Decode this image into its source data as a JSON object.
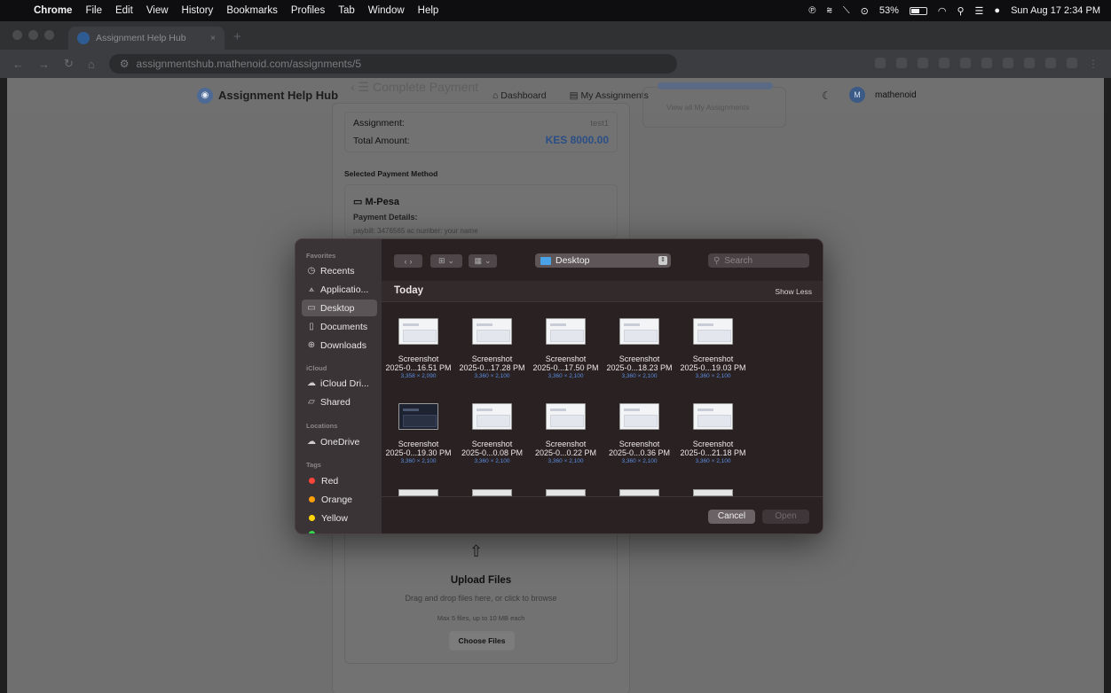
{
  "menubar": {
    "items": [
      "Chrome",
      "File",
      "Edit",
      "View",
      "History",
      "Bookmarks",
      "Profiles",
      "Tab",
      "Window",
      "Help"
    ],
    "battery": "53%",
    "datetime": "Sun Aug 17  2:34 PM"
  },
  "browser": {
    "tab_title": "Assignment Help Hub",
    "url": "assignmentshub.mathenoid.com/assignments/5"
  },
  "site": {
    "brand": "Assignment Help Hub",
    "nav_dashboard": "Dashboard",
    "nav_assignments": "My Assignments",
    "ghost_title": "Complete Payment",
    "avatar_initial": "M",
    "username": "mathenoid",
    "view_all": "View all My Assignments"
  },
  "payment": {
    "assignment_label": "Assignment:",
    "assignment_value": "test1",
    "total_label": "Total Amount:",
    "total_value": "KES 8000.00",
    "selected_method_label": "Selected Payment Method",
    "method_name": "M-Pesa",
    "details_label": "Payment Details:",
    "paybill_text": "paybill: 3476565 ac number: your name"
  },
  "upload": {
    "title": "Upload Files",
    "subtitle": "Drag and drop files here, or click to browse",
    "limits": "Max 5 files, up to 10 MB each",
    "button": "Choose Files"
  },
  "dialog": {
    "favorites_heading": "Favorites",
    "favorites": [
      "Recents",
      "Applicatio...",
      "Desktop",
      "Documents",
      "Downloads"
    ],
    "icloud_heading": "iCloud",
    "icloud": [
      "iCloud Dri...",
      "Shared"
    ],
    "locations_heading": "Locations",
    "locations": [
      "OneDrive"
    ],
    "tags_heading": "Tags",
    "tags": [
      {
        "name": "Red",
        "color": "#ff453a"
      },
      {
        "name": "Orange",
        "color": "#ff9f0a"
      },
      {
        "name": "Yellow",
        "color": "#ffd60a"
      }
    ],
    "location": "Desktop",
    "search_placeholder": "Search",
    "section": "Today",
    "show_less": "Show Less",
    "files": [
      {
        "line1": "Screenshot",
        "line2": "2025-0...16.51 PM",
        "dims": "3,358 × 2,090"
      },
      {
        "line1": "Screenshot",
        "line2": "2025-0...17.28 PM",
        "dims": "3,360 × 2,100"
      },
      {
        "line1": "Screenshot",
        "line2": "2025-0...17.50 PM",
        "dims": "3,360 × 2,100"
      },
      {
        "line1": "Screenshot",
        "line2": "2025-0...18.23 PM",
        "dims": "3,360 × 2,100"
      },
      {
        "line1": "Screenshot",
        "line2": "2025-0...19.03 PM",
        "dims": "3,360 × 2,100"
      },
      {
        "line1": "Screenshot",
        "line2": "2025-0...19.30 PM",
        "dims": "3,360 × 2,100"
      },
      {
        "line1": "Screenshot",
        "line2": "2025-0...0.08 PM",
        "dims": "3,360 × 2,100"
      },
      {
        "line1": "Screenshot",
        "line2": "2025-0...0.22 PM",
        "dims": "3,360 × 2,100"
      },
      {
        "line1": "Screenshot",
        "line2": "2025-0...0.36 PM",
        "dims": "3,360 × 2,100"
      },
      {
        "line1": "Screenshot",
        "line2": "2025-0...21.18 PM",
        "dims": "3,360 × 2,100"
      }
    ],
    "cancel": "Cancel",
    "open": "Open"
  }
}
